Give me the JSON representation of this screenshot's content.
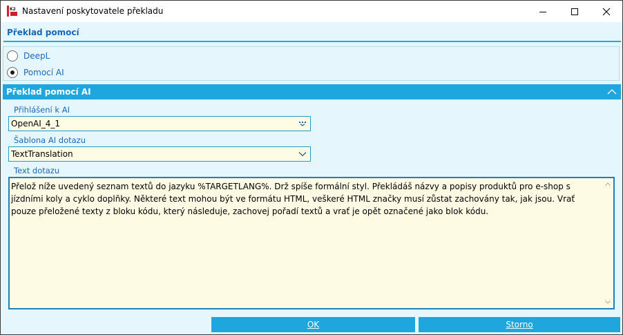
{
  "window": {
    "title": "Nastavení poskytovatele překladu",
    "controls": [
      "minimize-icon",
      "maximize-icon",
      "close-icon"
    ]
  },
  "section": {
    "title": "Překlad pomocí"
  },
  "provider_options": [
    {
      "label": "DeepL",
      "selected": false
    },
    {
      "label": "Pomocí AI",
      "selected": true
    }
  ],
  "ai_group": {
    "title": "Překlad pomocí AI",
    "collapse_icon": "chevron-up-icon",
    "login": {
      "label": "Přihlášení k AI",
      "value": "OpenAI_4_1",
      "button_icon": "lookup-dots-icon"
    },
    "template": {
      "label": "Šablona AI dotazu",
      "value": "TextTranslation",
      "button_icon": "chevron-down-icon"
    },
    "query": {
      "label": "Text dotazu",
      "value": "Přelož níže uvedený seznam textů do jazyku %TARGETLANG%. Drž spíše formální styl. Překládáš názvy a popisy produktů pro e-shop s jízdními koly a cyklo doplňky. Některé text mohou být ve formátu HTML, veškeré HTML značky musí zůstat zachovány tak, jak jsou. Vrať pouze přeložené texty z bloku kódu, který následuje, zachovej pořadí textů a vrať je opět označené jako blok kódu."
    }
  },
  "footer": {
    "ok_label": "OK",
    "cancel_label": "Storno"
  },
  "colors": {
    "accent": "#1ea6df",
    "label_blue": "#1a67b5",
    "panel_bg": "#e6f6fd",
    "input_bg": "#fdfbe3"
  }
}
